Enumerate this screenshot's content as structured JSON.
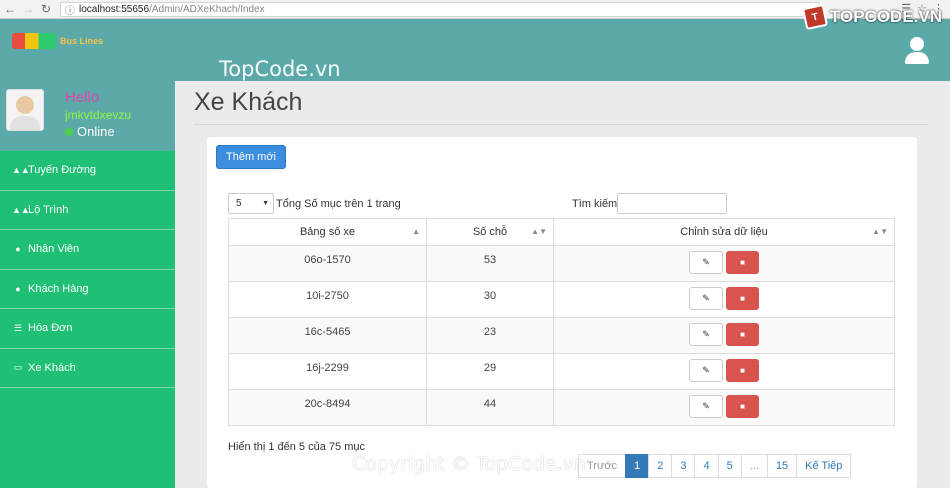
{
  "browser": {
    "url_host": "localhost:55656",
    "url_path": "/Admin/ADXeKhach/Index"
  },
  "header": {
    "logo_name": "Bus Lines",
    "watermark": "TopCode.vn",
    "brand": "TOPCODE.VN"
  },
  "profile": {
    "greeting": "Hello",
    "username": "jmkvtdxevzu",
    "status": "Online"
  },
  "sidebar": {
    "items": [
      {
        "label": "Tuyến Đường",
        "icon": "road-icon"
      },
      {
        "label": "Lộ Trình",
        "icon": "road-icon"
      },
      {
        "label": "Nhân Viên",
        "icon": "user-icon"
      },
      {
        "label": "Khách Hàng",
        "icon": "user-icon"
      },
      {
        "label": "Hóa Đơn",
        "icon": "list-icon"
      },
      {
        "label": "Xe Khách",
        "icon": "credit-card-icon"
      }
    ]
  },
  "main": {
    "title": "Xe Khách",
    "add_button": "Thêm mới",
    "page_size": "5",
    "page_size_label": "Tổng Số mục trên 1 trang",
    "search_label": "Tìm kiếm:",
    "search_value": "",
    "columns": [
      "Bảng số xe",
      "Số chỗ",
      "Chỉnh sửa dữ liệu"
    ],
    "rows": [
      {
        "plate": "06o-1570",
        "seats": "53"
      },
      {
        "plate": "10i-2750",
        "seats": "30"
      },
      {
        "plate": "16c-5465",
        "seats": "23"
      },
      {
        "plate": "16j-2299",
        "seats": "29"
      },
      {
        "plate": "20c-8494",
        "seats": "44"
      }
    ],
    "info": "Hiển thị 1 đến 5 của 75 mục",
    "pagination": {
      "prev": "Trước",
      "pages": [
        "1",
        "2",
        "3",
        "4",
        "5",
        "...",
        "15"
      ],
      "next": "Kế Tiếp",
      "active": "1"
    }
  },
  "footer": {
    "watermark": "Copyright © TopCode.vn"
  },
  "colors": {
    "header_teal": "#5ca9aa",
    "sidebar_green": "#1fbf75",
    "primary_blue": "#3c8dde",
    "danger_red": "#d9534f"
  }
}
